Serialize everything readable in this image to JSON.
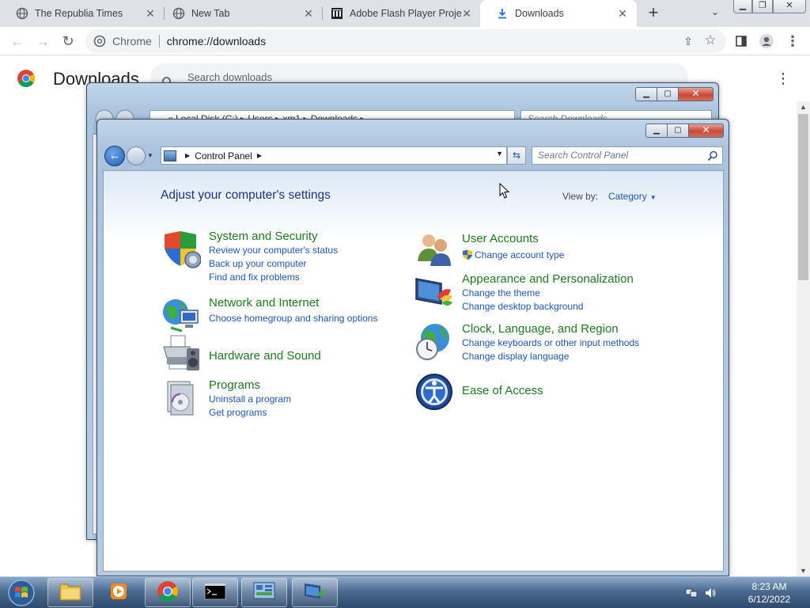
{
  "browser": {
    "tabs": [
      {
        "title": "The Republia Times",
        "icon": "globe-icon"
      },
      {
        "title": "New Tab",
        "icon": "globe-icon"
      },
      {
        "title": "Adobe Flash Player Proje",
        "icon": "museum-icon"
      },
      {
        "title": "Downloads",
        "icon": "download-icon",
        "active": true
      }
    ],
    "omnibox": {
      "site": "Chrome",
      "url": "chrome://downloads"
    }
  },
  "downloads_page": {
    "title": "Downloads",
    "search_placeholder": "Search downloads"
  },
  "explorer_window": {
    "address": "«  Local Disk (C:)  ▸  Users  ▸  xm1  ▸  Downloads  ▸",
    "search_placeholder": "Search Downloads"
  },
  "control_panel": {
    "address": "Control Panel",
    "search_placeholder": "Search Control Panel",
    "heading": "Adjust your computer's settings",
    "view_by_label": "View by:",
    "view_by_value": "Category",
    "left_categories": [
      {
        "name": "System and Security",
        "icon": "shield-icon",
        "links": [
          "Review your computer's status",
          "Back up your computer",
          "Find and fix problems"
        ]
      },
      {
        "name": "Network and Internet",
        "icon": "network-icon",
        "links": [
          "Choose homegroup and sharing options"
        ]
      },
      {
        "name": "Hardware and Sound",
        "icon": "printer-icon",
        "links": []
      },
      {
        "name": "Programs",
        "icon": "programs-icon",
        "links": [
          "Uninstall a program",
          "Get programs"
        ]
      }
    ],
    "right_categories": [
      {
        "name": "User Accounts",
        "icon": "users-icon",
        "links": [
          "Change account type"
        ]
      },
      {
        "name": "Appearance and Personalization",
        "icon": "monitor-paint-icon",
        "links": [
          "Change the theme",
          "Change desktop background"
        ]
      },
      {
        "name": "Clock, Language, and Region",
        "icon": "globe-clock-icon",
        "links": [
          "Change keyboards or other input methods",
          "Change display language"
        ]
      },
      {
        "name": "Ease of Access",
        "icon": "ease-of-access-icon",
        "links": []
      }
    ]
  },
  "taskbar": {
    "time": "8:23 AM",
    "date": "6/12/2022"
  },
  "colors": {
    "category_green": "#1e7a20",
    "link_blue": "#1f56b8",
    "heading_blue": "#1e3287"
  }
}
